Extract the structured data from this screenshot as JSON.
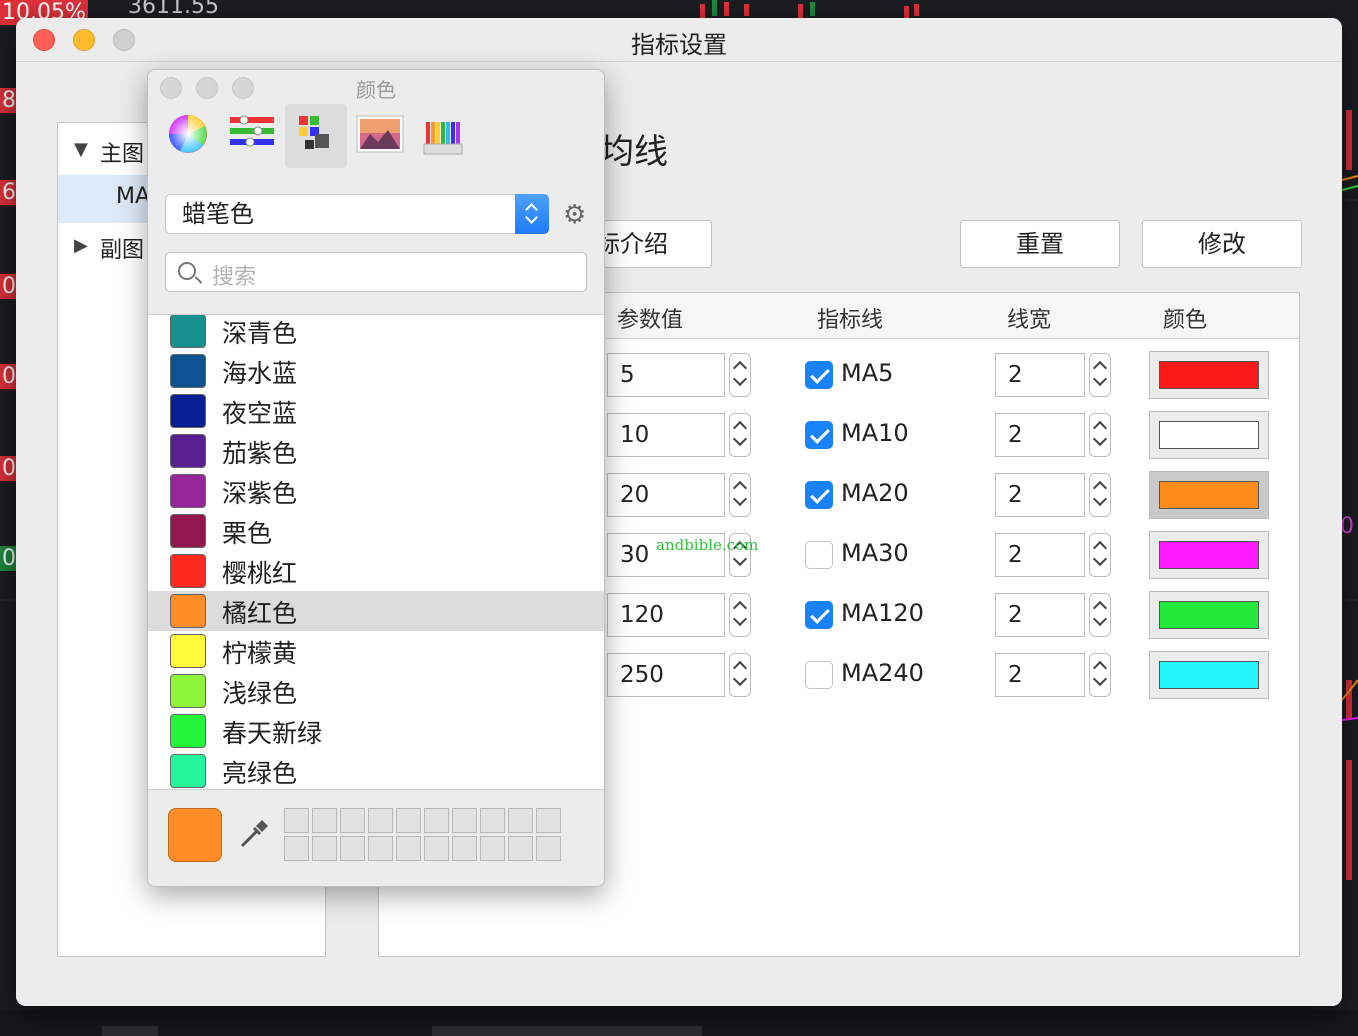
{
  "background": {
    "top_percent": "10.05%",
    "top_price": "3611.55",
    "left_labels": [
      "8.",
      "6.",
      "0.",
      "0.",
      "0.",
      "0."
    ],
    "right_label": "0"
  },
  "window": {
    "title": "指标设置"
  },
  "tree": {
    "items": [
      {
        "arrow": "▼",
        "label": "主图"
      },
      {
        "arrow": "",
        "label": "MA"
      },
      {
        "arrow": "▶",
        "label": "副图"
      }
    ]
  },
  "main": {
    "heading_partial": "均线",
    "intro_button": "指标介绍",
    "reset_button": "重置",
    "modify_button": "修改"
  },
  "table": {
    "headers": {
      "param": "参数值",
      "line": "指标线",
      "width": "线宽",
      "color": "颜色"
    },
    "rows": [
      {
        "param": "5",
        "checked": true,
        "line": "MA5",
        "width": "2",
        "color": "#ff1a1a"
      },
      {
        "param": "10",
        "checked": true,
        "line": "MA10",
        "width": "2",
        "color": "#ffffff"
      },
      {
        "param": "20",
        "checked": true,
        "line": "MA20",
        "width": "2",
        "color": "#ff8c1a"
      },
      {
        "param": "30",
        "checked": false,
        "line": "MA30",
        "width": "2",
        "color": "#ff1aff"
      },
      {
        "param": "120",
        "checked": true,
        "line": "MA120",
        "width": "2",
        "color": "#22e83a"
      },
      {
        "param": "250",
        "checked": false,
        "line": "MA240",
        "width": "2",
        "color": "#22f5ff"
      }
    ]
  },
  "watermark": "andbible.com",
  "picker": {
    "title": "颜色",
    "modes": [
      "color-wheel",
      "color-sliders",
      "color-palettes",
      "image-palettes",
      "pencils"
    ],
    "palette_name": "蜡笔色",
    "search_placeholder": "搜索",
    "selected_index": 7,
    "colors": [
      {
        "name": "深青色",
        "hex": "#168f8f"
      },
      {
        "name": "海水蓝",
        "hex": "#0d5391"
      },
      {
        "name": "夜空蓝",
        "hex": "#061f92"
      },
      {
        "name": "茄紫色",
        "hex": "#5a1f92"
      },
      {
        "name": "深紫色",
        "hex": "#97259a"
      },
      {
        "name": "栗色",
        "hex": "#92174e"
      },
      {
        "name": "樱桃红",
        "hex": "#ff2a1e"
      },
      {
        "name": "橘红色",
        "hex": "#ff8c26"
      },
      {
        "name": "柠檬黄",
        "hex": "#fffa3a"
      },
      {
        "name": "浅绿色",
        "hex": "#8ef53a"
      },
      {
        "name": "春天新绿",
        "hex": "#24f538"
      },
      {
        "name": "亮绿色",
        "hex": "#24f59a"
      }
    ],
    "current_color": "#ff8c26"
  }
}
